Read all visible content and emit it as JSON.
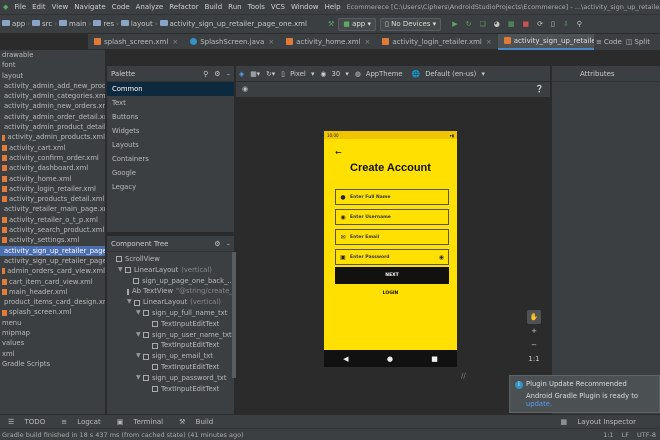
{
  "menu": [
    "File",
    "Edit",
    "View",
    "Navigate",
    "Code",
    "Analyze",
    "Refactor",
    "Build",
    "Run",
    "Tools",
    "VCS",
    "Window",
    "Help"
  ],
  "window_title": "Ecommerece [C:\\Users\\Ciphers\\AndroidStudioProjects\\Ecommerece] - ...\\activity_sign_up_retailer_page_one.xml [app]",
  "breadcrumb": [
    "app",
    "src",
    "main",
    "res",
    "layout",
    "activity_sign_up_retailer_page_one.xml"
  ],
  "toolbar": {
    "config": "app",
    "device": "No Devices"
  },
  "editor_tabs": [
    {
      "label": "splash_screen.xml",
      "type": "xml"
    },
    {
      "label": "SplashScreen.java",
      "type": "java"
    },
    {
      "label": "activity_home.xml",
      "type": "xml"
    },
    {
      "label": "activity_login_retailer.xml",
      "type": "xml"
    },
    {
      "label": "activity_sign_up_retailer_page_one.xml",
      "type": "xml",
      "active": true
    }
  ],
  "view_modes": {
    "code": "Code",
    "split": "Split",
    "design": "Design"
  },
  "project_tree": {
    "top": [
      "drawable",
      "font",
      "layout"
    ],
    "files": [
      "activity_admin_add_new_product.xml",
      "activity_admin_categories.xml",
      "activity_admin_new_orders.xml",
      "activity_admin_order_detail.xml",
      "activity_admin_product_detail.xml",
      "activity_admin_products.xml",
      "activity_cart.xml",
      "activity_confirm_order.xml",
      "activity_dashboard.xml",
      "activity_home.xml",
      "activity_login_retailer.xml",
      "activity_products_detail.xml",
      "activity_retailer_main_page.xml",
      "activity_retailer_o_t_p.xml",
      "activity_search_product.xml",
      "activity_settings.xml",
      "activity_sign_up_retailer_page_one.xml",
      "activity_sign_up_retailer_page_two.xml",
      "admin_orders_card_view.xml",
      "cart_item_card_view.xml",
      "main_header.xml",
      "product_items_card_design.xml",
      "splash_screen.xml"
    ],
    "selected": "activity_sign_up_retailer_page_one.xml",
    "bottom": [
      "menu",
      "mipmap",
      "values",
      "xml",
      "Gradle Scripts"
    ]
  },
  "palette": {
    "title": "Palette",
    "categories": [
      "Common",
      "Text",
      "Buttons",
      "Widgets",
      "Layouts",
      "Containers",
      "Google",
      "Legacy"
    ],
    "selected": "Common"
  },
  "component_tree": {
    "title": "Component Tree",
    "nodes": [
      {
        "label": "ScrollView",
        "hint": "",
        "depth": 0
      },
      {
        "label": "LinearLayout",
        "hint": "(vertical)",
        "depth": 1
      },
      {
        "label": "sign_up_page_one_back_...",
        "hint": "",
        "depth": 2
      },
      {
        "label": "Ab TextView",
        "hint": "\"@string/create_...",
        "depth": 2
      },
      {
        "label": "LinearLayout",
        "hint": "(vertical)",
        "depth": 2
      },
      {
        "label": "sign_up_full_name_txt",
        "hint": "",
        "depth": 3
      },
      {
        "label": "TextInputEditText",
        "hint": "",
        "depth": 4
      },
      {
        "label": "sign_up_user_name_txt",
        "hint": "",
        "depth": 3
      },
      {
        "label": "TextInputEditText",
        "hint": "",
        "depth": 4
      },
      {
        "label": "sign_up_email_txt",
        "hint": "",
        "depth": 3
      },
      {
        "label": "TextInputEditText",
        "hint": "",
        "depth": 4
      },
      {
        "label": "sign_up_password_txt",
        "hint": "",
        "depth": 3
      },
      {
        "label": "TextInputEditText",
        "hint": "",
        "depth": 4
      }
    ]
  },
  "design_toolbar": {
    "device": "Pixel",
    "api": "30",
    "theme": "AppTheme",
    "locale": "Default (en-us)"
  },
  "attributes": {
    "title": "Attributes"
  },
  "phone": {
    "time": "10:00",
    "title": "Create Account",
    "fields": [
      {
        "icon": "person-icon",
        "placeholder": "Enter Full Name"
      },
      {
        "icon": "account-icon",
        "placeholder": "Enter Username"
      },
      {
        "icon": "mail-icon",
        "placeholder": "Enter Email"
      },
      {
        "icon": "lock-icon",
        "placeholder": "Enter Password"
      }
    ],
    "next": "NEXT",
    "login": "LOGIN"
  },
  "zoom": {
    "plus": "+",
    "minus": "−",
    "ratio": "1:1"
  },
  "notification": {
    "title": "Plugin Update Recommended",
    "body": "Android Gradle Plugin is ready to ",
    "link": "update."
  },
  "bottom_tools": [
    "TODO",
    "Logcat",
    "Terminal",
    "Build"
  ],
  "layout_inspector": "Layout Inspector",
  "status": {
    "message": "Gradle build finished in 18 s 437 ms (from cached state) (41 minutes ago)",
    "pos": "1:1",
    "sep": "LF",
    "enc": "UTF-8"
  }
}
